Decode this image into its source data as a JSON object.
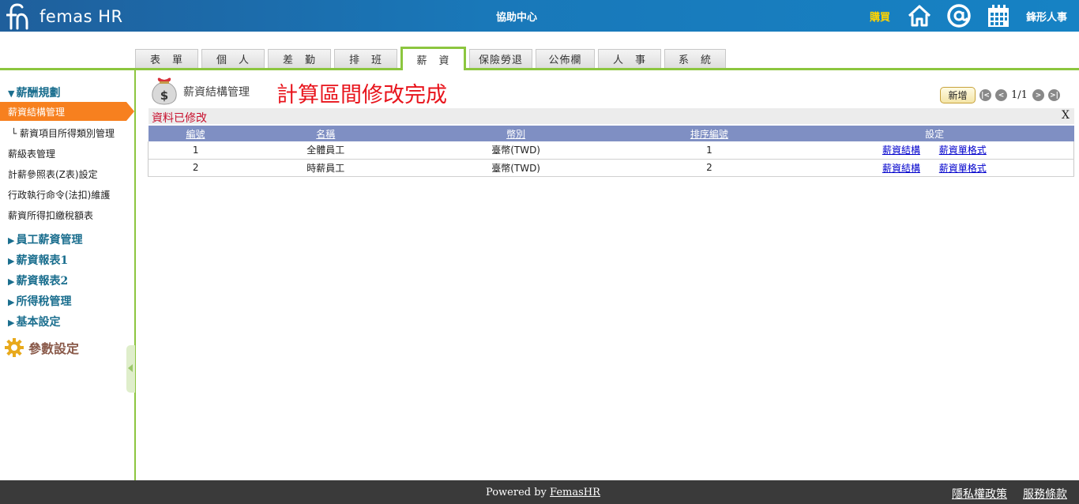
{
  "header": {
    "logo_text": "femas HR",
    "help_center": "協助中心",
    "buy": "購買",
    "company": "鋒形人事"
  },
  "tabs": [
    {
      "label": "表　單",
      "active": false
    },
    {
      "label": "個　人",
      "active": false
    },
    {
      "label": "差　勤",
      "active": false
    },
    {
      "label": "排　班",
      "active": false
    },
    {
      "label": "薪　資",
      "active": true
    },
    {
      "label": "保險勞退",
      "active": false
    },
    {
      "label": "公佈欄",
      "active": false
    },
    {
      "label": "人　事",
      "active": false
    },
    {
      "label": "系　統",
      "active": false
    }
  ],
  "sidebar": {
    "section_open": "薪酬規劃",
    "items": [
      {
        "label": "薪資結構管理",
        "active": true
      },
      {
        "label": "└ 薪資項目所得類別管理",
        "active": false
      },
      {
        "label": "薪級表管理",
        "active": false
      },
      {
        "label": "計薪參照表(Z表)設定",
        "active": false
      },
      {
        "label": "行政執行命令(法扣)維護",
        "active": false
      },
      {
        "label": "薪資所得扣繳稅額表",
        "active": false
      }
    ],
    "sections_closed": [
      "員工薪資管理",
      "薪資報表1",
      "薪資報表2",
      "所得稅管理",
      "基本設定"
    ],
    "param_label": "參數設定"
  },
  "main": {
    "page_title": "薪資結構管理",
    "message": "計算區間修改完成",
    "add_button": "新增",
    "pager": {
      "first": "|<",
      "prev": "<",
      "info": "1/1",
      "next": ">",
      "last": ">|"
    },
    "notice": "資料已修改",
    "notice_close": "X",
    "table": {
      "headers": [
        "編號",
        "名稱",
        "幣別",
        "排序編號",
        "設定"
      ],
      "rows": [
        {
          "id": "1",
          "name": "全體員工",
          "currency": "臺幣(TWD)",
          "order": "1",
          "link1": "薪資結構",
          "link2": "薪資單格式"
        },
        {
          "id": "2",
          "name": "時薪員工",
          "currency": "臺幣(TWD)",
          "order": "2",
          "link1": "薪資結構",
          "link2": "薪資單格式"
        }
      ]
    }
  },
  "footer": {
    "powered_prefix": "Powered by ",
    "powered_link": "FemasHR",
    "privacy": "隱私權政策",
    "terms": "服務條款"
  }
}
